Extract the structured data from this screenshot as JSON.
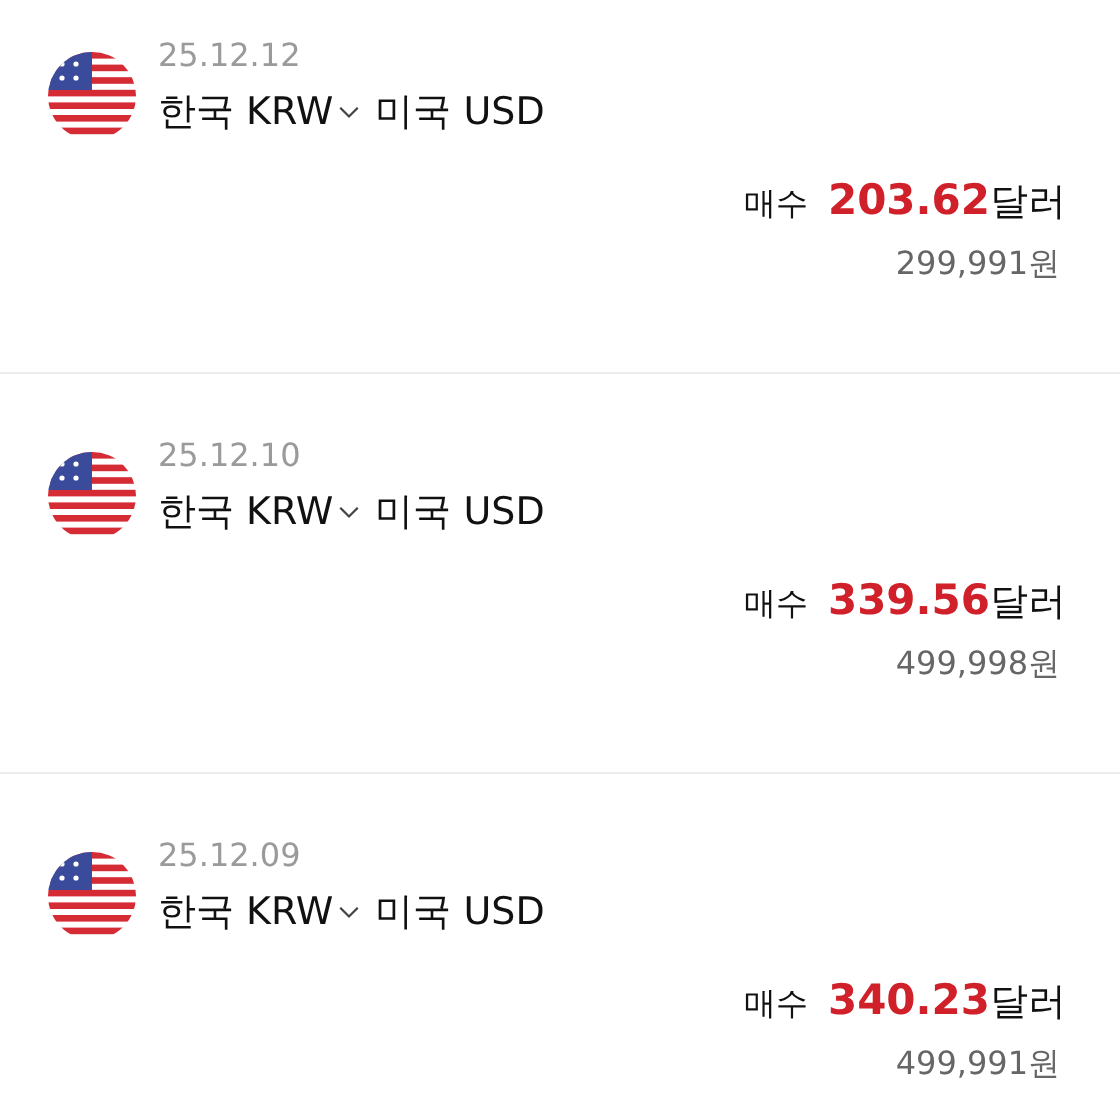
{
  "transactions": [
    {
      "date": "25.12.12",
      "from": "한국 KRW",
      "to": "미국 USD",
      "side": "매수",
      "amount": "203.62",
      "unit": "달러",
      "krw": "299,991원"
    },
    {
      "date": "25.12.10",
      "from": "한국 KRW",
      "to": "미국 USD",
      "side": "매수",
      "amount": "339.56",
      "unit": "달러",
      "krw": "499,998원"
    },
    {
      "date": "25.12.09",
      "from": "한국 KRW",
      "to": "미국 USD",
      "side": "매수",
      "amount": "340.23",
      "unit": "달러",
      "krw": "499,991원"
    }
  ]
}
